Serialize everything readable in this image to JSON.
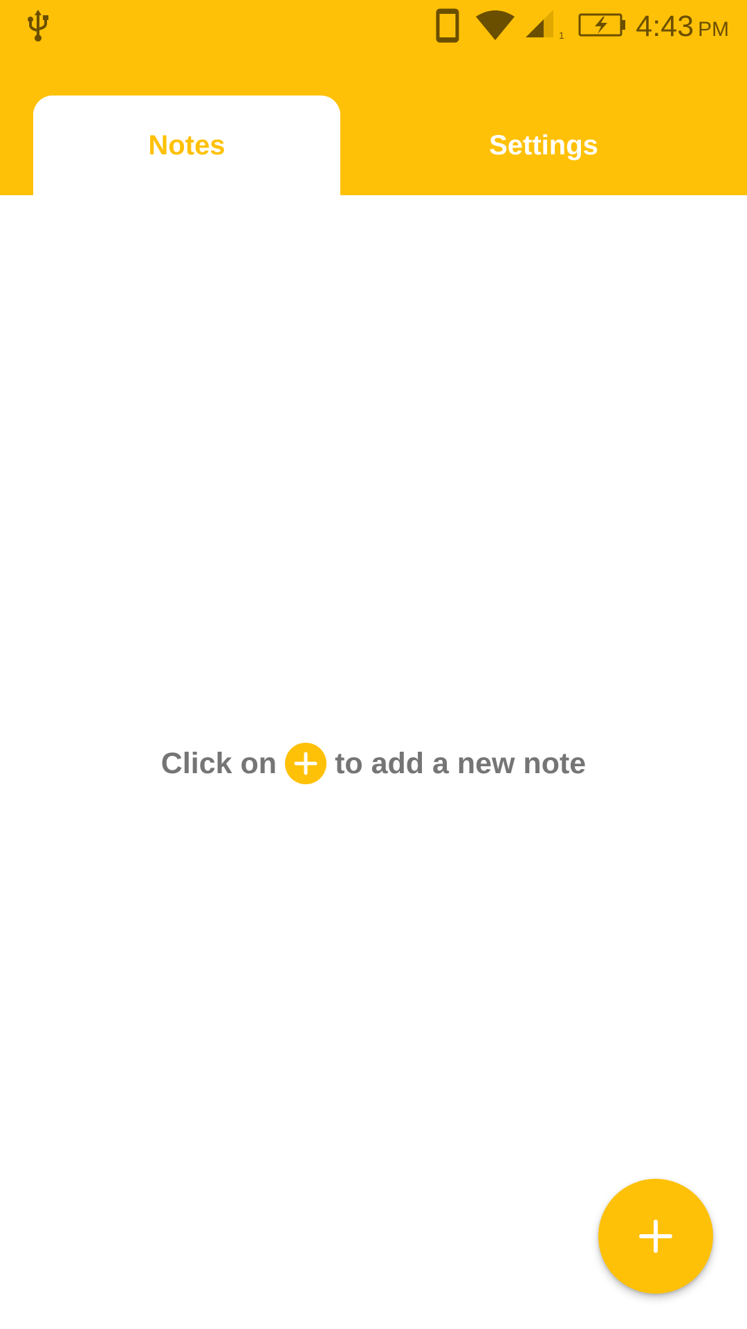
{
  "status_bar": {
    "time": "4:43",
    "meridiem": "PM",
    "icons": [
      "usb-icon",
      "phone-icon",
      "wifi-icon",
      "signal-icon",
      "battery-charging-icon"
    ],
    "sim_slot": "1"
  },
  "tabs": [
    {
      "label": "Notes",
      "selected": true
    },
    {
      "label": "Settings",
      "selected": false
    }
  ],
  "empty_state": {
    "prefix": "Click on",
    "suffix": "to add a new note",
    "icon": "add-circle-icon"
  },
  "fab": {
    "icon": "plus-icon"
  },
  "colors": {
    "accent": "#FFC107",
    "status_icons": "#6B4F00",
    "hint_text": "#757575",
    "background": "#FFFFFF"
  }
}
